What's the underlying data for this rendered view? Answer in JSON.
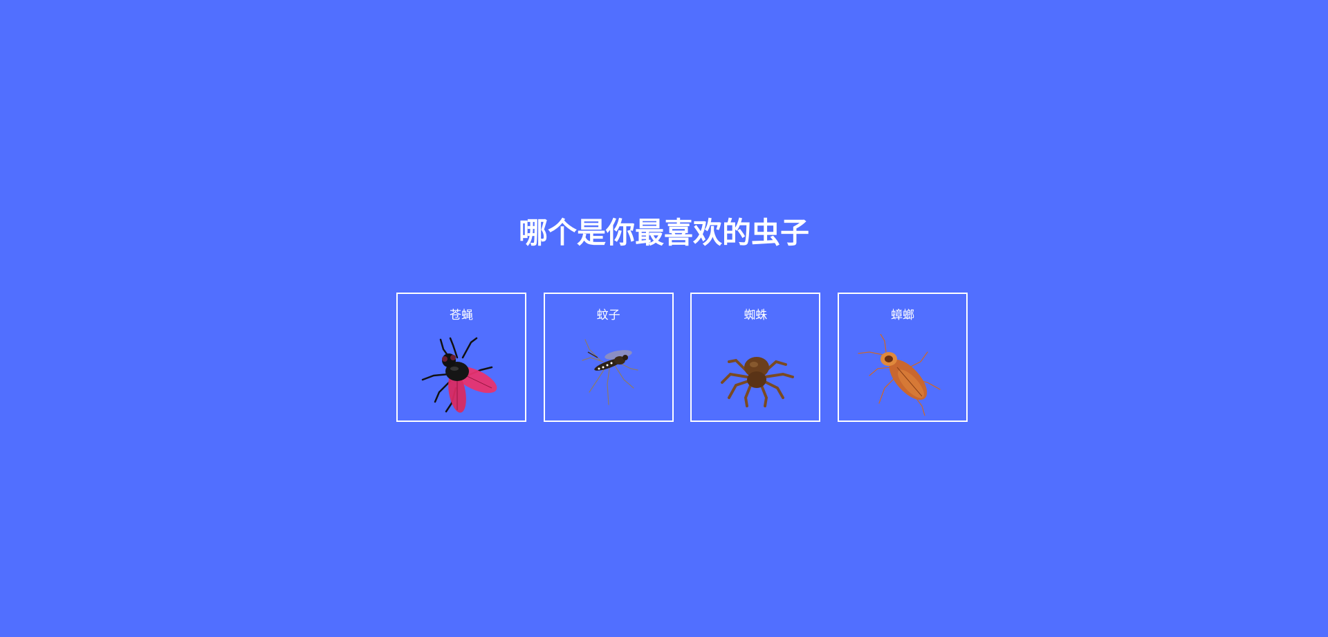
{
  "page": {
    "title": "哪个是你最喜欢的虫子",
    "background_color": "#516fff",
    "border_color": "#ffffff"
  },
  "bugs": [
    {
      "label": "苍蝇",
      "icon": "fly-icon",
      "colors": {
        "body": "#111111",
        "wing": "#e8336f"
      }
    },
    {
      "label": "蚊子",
      "icon": "mosquito-icon",
      "colors": {
        "body": "#3a2a1a",
        "legs": "#8c7a68"
      }
    },
    {
      "label": "蜘蛛",
      "icon": "spider-icon",
      "colors": {
        "body": "#6b3f1c",
        "legs": "#7a4a22"
      }
    },
    {
      "label": "蟑螂",
      "icon": "cockroach-icon",
      "colors": {
        "body": "#c9672f",
        "head": "#e0893c"
      }
    }
  ]
}
